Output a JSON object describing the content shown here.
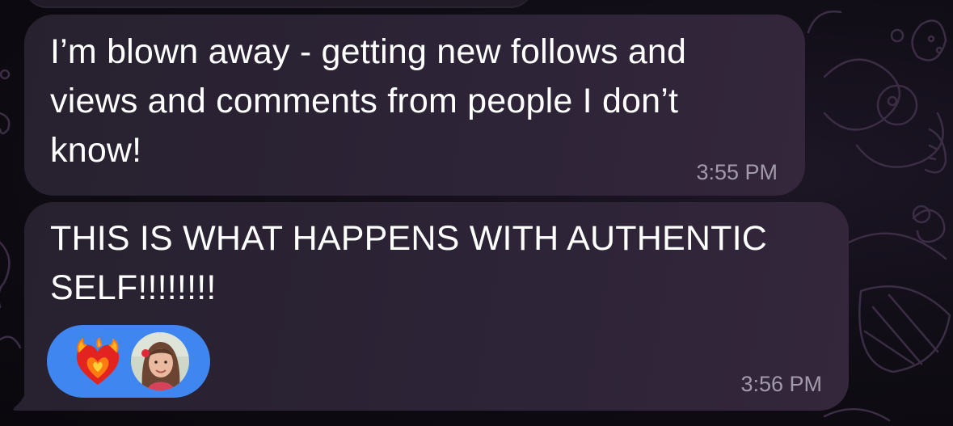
{
  "messages": [
    {
      "text": "I’m blown away - getting new follows and\nviews and comments from people I don’t\nknow!",
      "time": "3:55 PM"
    },
    {
      "text": "THIS IS WHAT HAPPENS WITH AUTHENTIC\nSELF!!!!!!!!",
      "time": "3:56 PM",
      "reaction": {
        "emoji_icon": "heart-on-fire-icon",
        "avatar_icon": "user-avatar",
        "pill_color": "#3f86f0"
      }
    }
  ],
  "colors": {
    "bubble": "#2a2333",
    "timestamp": "#a29bab",
    "background": "#0c0a10"
  }
}
